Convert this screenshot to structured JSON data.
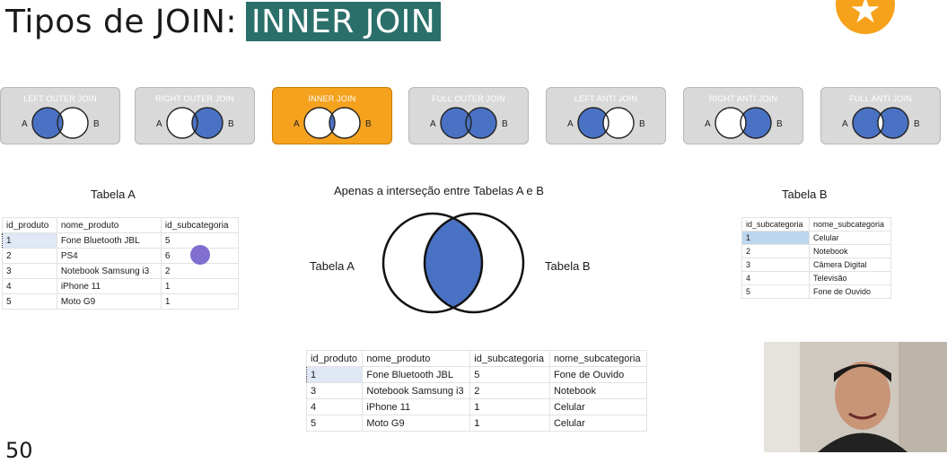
{
  "title": {
    "prefix": "Tipos de JOIN:",
    "highlight": "INNER JOIN"
  },
  "page_number": "50",
  "colors": {
    "accent": "#f5a21f",
    "highlight_bg": "#2b6f6a",
    "venn_fill": "#4a72c4"
  },
  "join_types": [
    {
      "label": "LEFT OUTER JOIN",
      "a": "A",
      "b": "B"
    },
    {
      "label": "RIGHT OUTER JOIN",
      "a": "A",
      "b": "B"
    },
    {
      "label": "INNER JOIN",
      "a": "A",
      "b": "B"
    },
    {
      "label": "FULL OUTER JOIN",
      "a": "A",
      "b": "B"
    },
    {
      "label": "LEFT ANTI JOIN",
      "a": "A",
      "b": "B"
    },
    {
      "label": "RIGHT ANTI JOIN",
      "a": "A",
      "b": "B"
    },
    {
      "label": "FULL ANTI JOIN",
      "a": "A",
      "b": "B"
    }
  ],
  "active_join": "INNER JOIN",
  "table_a": {
    "title": "Tabela A",
    "headers": [
      "id_produto",
      "nome_produto",
      "id_subcategoria"
    ],
    "rows": [
      [
        "1",
        "Fone Bluetooth JBL",
        "5"
      ],
      [
        "2",
        "PS4",
        "6"
      ],
      [
        "3",
        "Notebook Samsung i3",
        "2"
      ],
      [
        "4",
        "iPhone 11",
        "1"
      ],
      [
        "5",
        "Moto G9",
        "1"
      ]
    ]
  },
  "table_b": {
    "title": "Tabela B",
    "headers": [
      "id_subcategoria",
      "nome_subcategoria"
    ],
    "rows": [
      [
        "1",
        "Celular"
      ],
      [
        "2",
        "Notebook"
      ],
      [
        "3",
        "Câmera Digital"
      ],
      [
        "4",
        "Televisão"
      ],
      [
        "5",
        "Fone de Ouvido"
      ]
    ]
  },
  "venn": {
    "caption": "Apenas a interseção entre Tabelas A e B",
    "left_label": "Tabela A",
    "right_label": "Tabela B"
  },
  "result_table": {
    "headers": [
      "id_produto",
      "nome_produto",
      "id_subcategoria",
      "nome_subcategoria"
    ],
    "rows": [
      [
        "1",
        "Fone Bluetooth JBL",
        "5",
        "Fone de Ouvido"
      ],
      [
        "3",
        "Notebook Samsung i3",
        "2",
        "Notebook"
      ],
      [
        "4",
        "iPhone 11",
        "1",
        "Celular"
      ],
      [
        "5",
        "Moto G9",
        "1",
        "Celular"
      ]
    ]
  }
}
